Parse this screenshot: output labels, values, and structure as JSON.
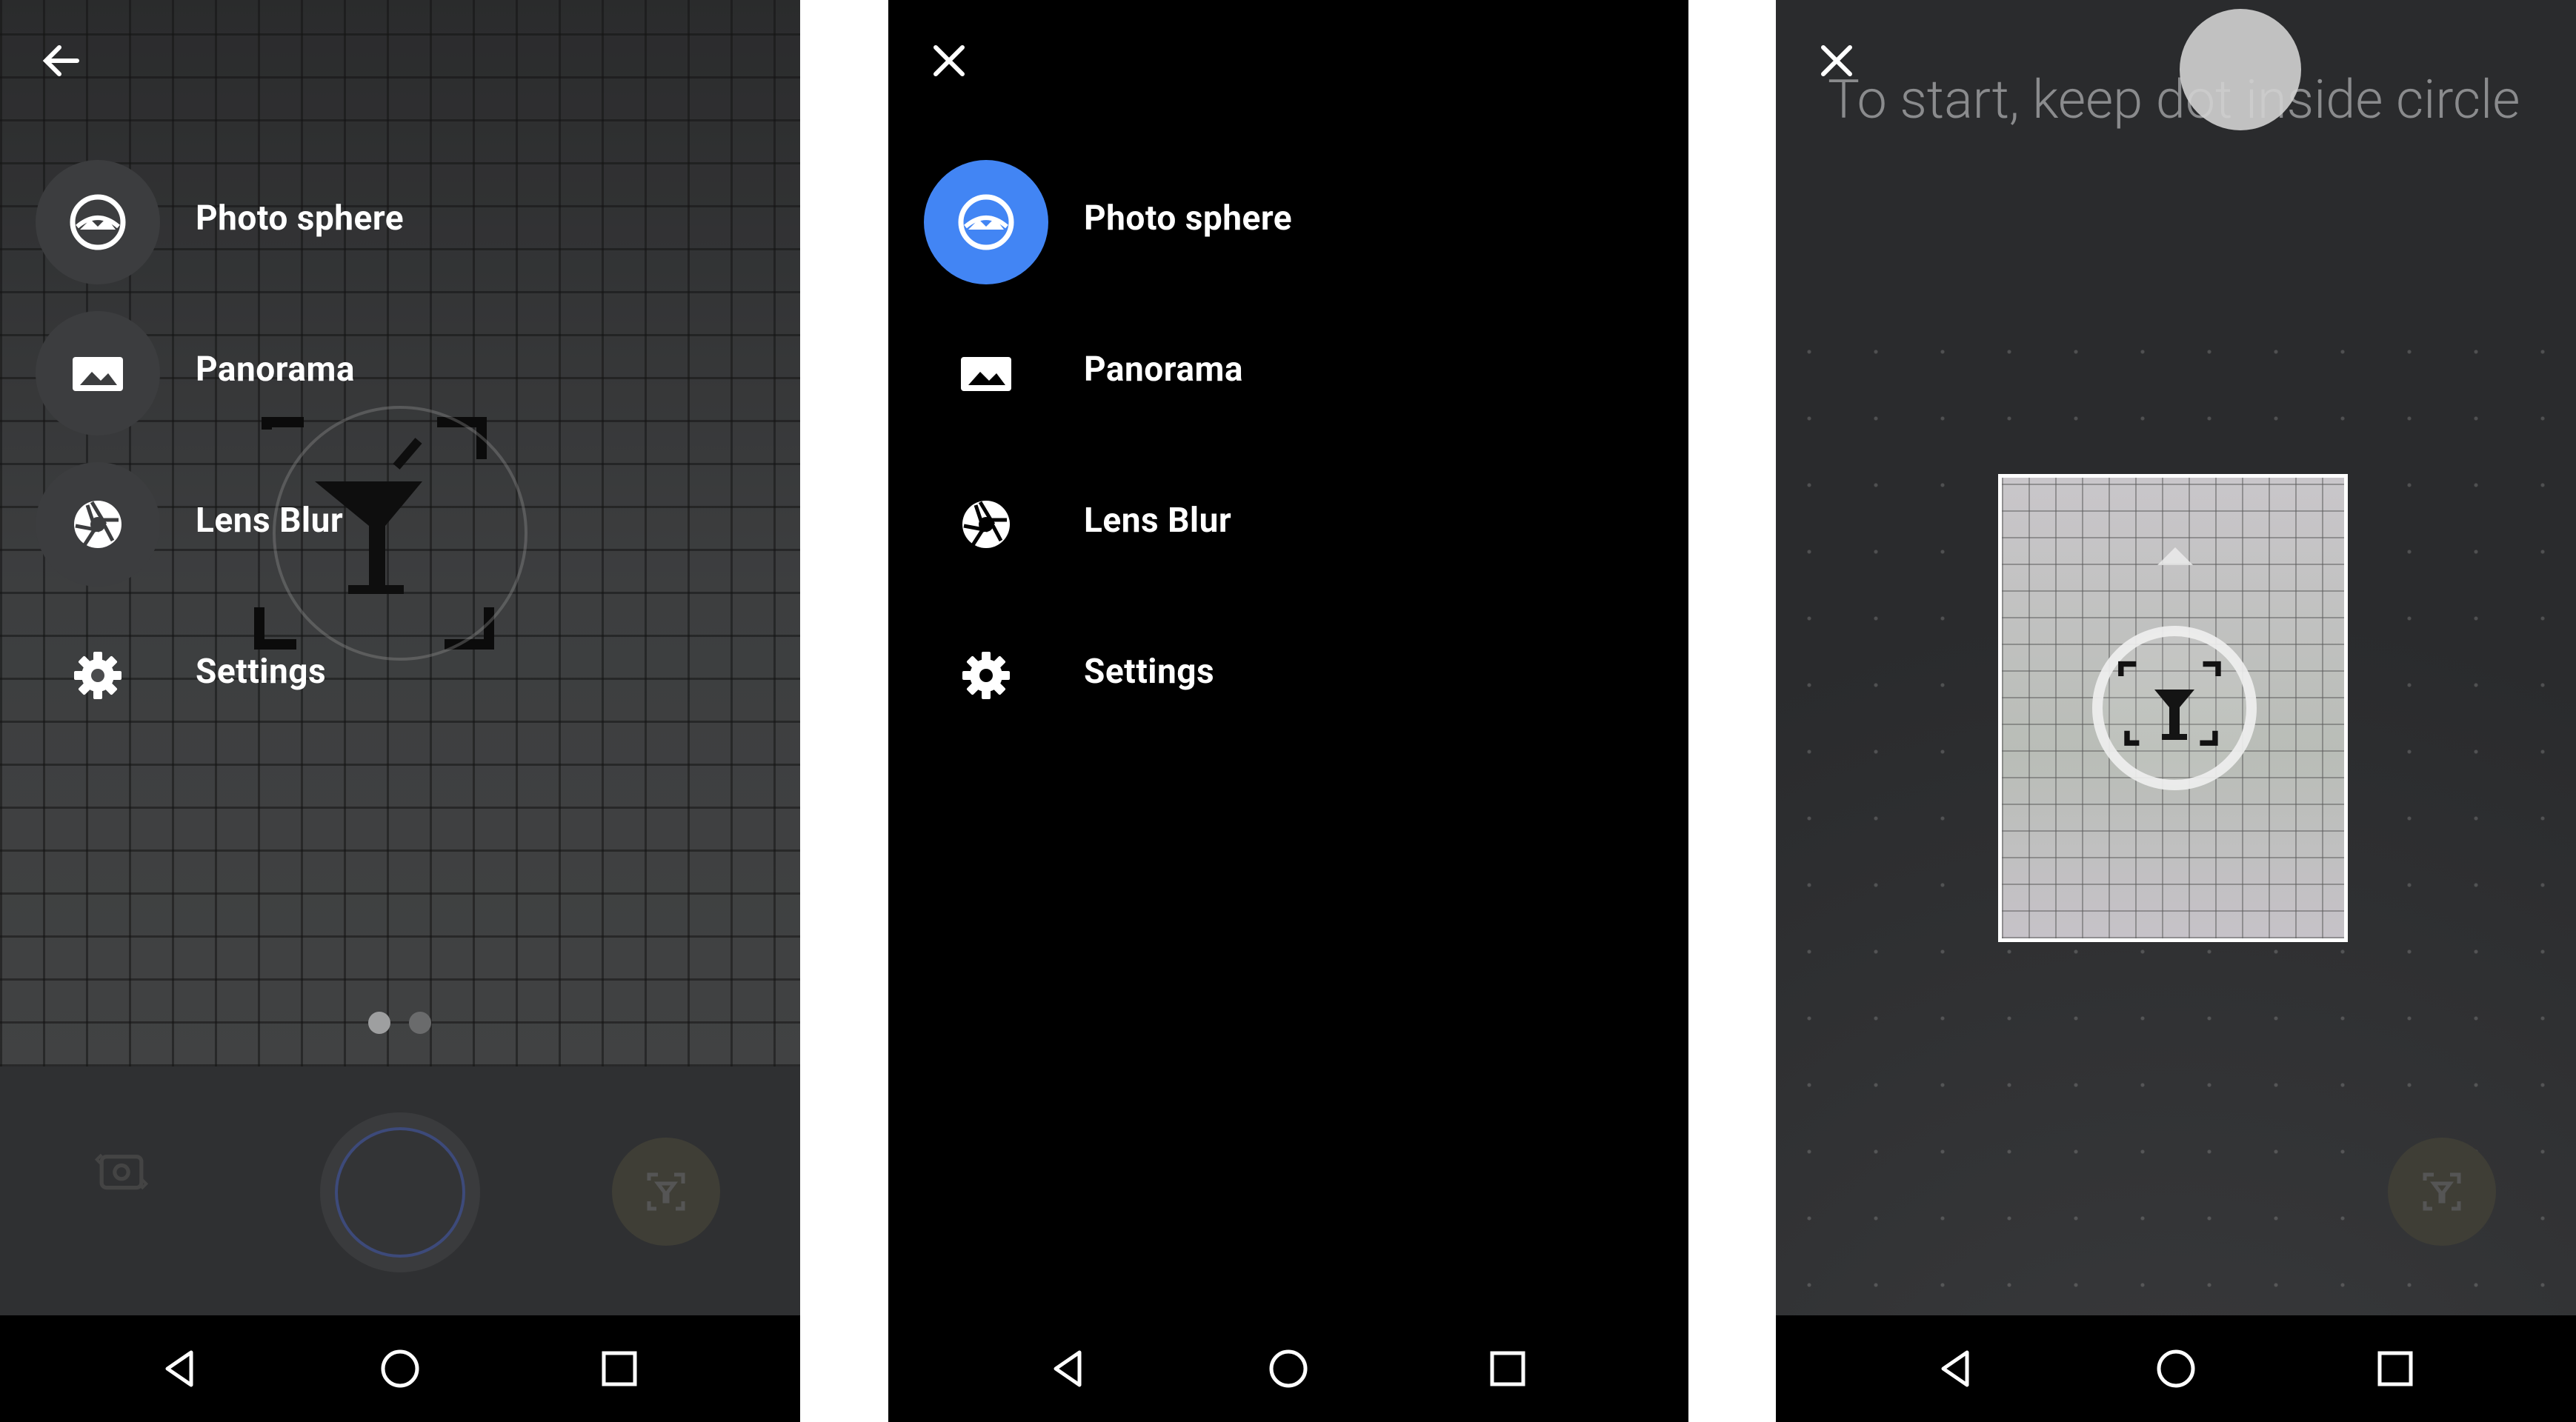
{
  "screens": [
    {
      "id": "mode-menu-over-viewfinder",
      "menu": [
        {
          "label": "Photo sphere",
          "icon": "photo-sphere-icon"
        },
        {
          "label": "Panorama",
          "icon": "panorama-icon"
        },
        {
          "label": "Lens Blur",
          "icon": "lens-blur-icon"
        },
        {
          "label": "Settings",
          "icon": "settings-icon"
        }
      ],
      "pager": {
        "pages": 2,
        "current": 1
      }
    },
    {
      "id": "mode-menu-black",
      "menu": [
        {
          "label": "Photo sphere",
          "icon": "photo-sphere-icon",
          "selected": true
        },
        {
          "label": "Panorama",
          "icon": "panorama-icon"
        },
        {
          "label": "Lens Blur",
          "icon": "lens-blur-icon"
        },
        {
          "label": "Settings",
          "icon": "settings-icon"
        }
      ]
    },
    {
      "id": "photo-sphere-capture",
      "hint": "To start, keep dot inside circle"
    }
  ],
  "colors": {
    "accent": "#4285f4",
    "menu_circle": "#3c3d3f",
    "navbar": "#000000"
  }
}
